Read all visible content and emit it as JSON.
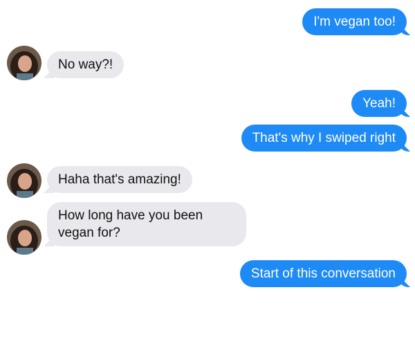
{
  "conversation": {
    "messages": [
      {
        "direction": "sent",
        "text": "I'm vegan too!"
      },
      {
        "direction": "received",
        "text": "No way?!"
      },
      {
        "direction": "sent",
        "text": "Yeah!"
      },
      {
        "direction": "sent",
        "text": "That's why I swiped right"
      },
      {
        "direction": "received",
        "text": "Haha that's amazing!"
      },
      {
        "direction": "received",
        "lines": [
          "How long have you been",
          "vegan for?"
        ]
      },
      {
        "direction": "sent",
        "text": "Start of this conversation"
      }
    ]
  },
  "colors": {
    "sent_bubble": "#1e8af5",
    "received_bubble": "#e8e8ed",
    "background": "#ffffff"
  },
  "icons": {
    "contact_avatar": "contact-avatar-photo"
  }
}
